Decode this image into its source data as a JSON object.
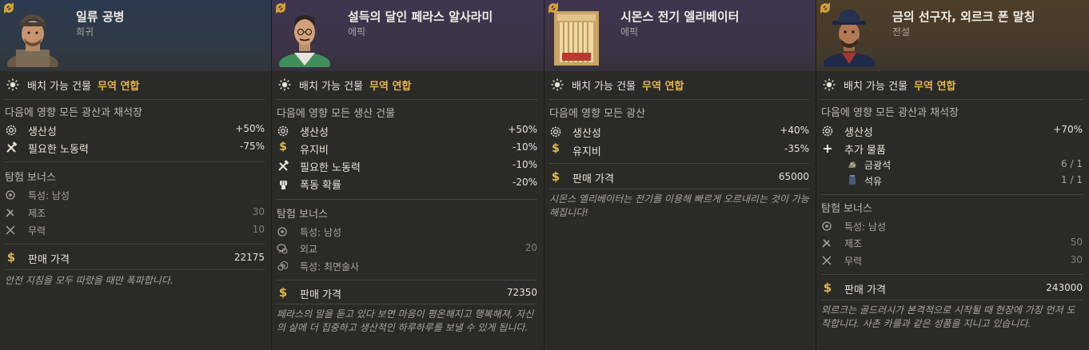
{
  "common": {
    "deploy_label": "배치 가능 건물",
    "deploy_value": "무역 연합",
    "explore_bonus": "탐험 보너스",
    "sell_price": "판매 가격"
  },
  "cards": [
    {
      "name": "일류 공병",
      "rarity": "희귀",
      "affects": "다음에 영향 모든 광산과 채석장",
      "stats": [
        {
          "icon": "gear-icon",
          "label": "생산성",
          "value": "+50%"
        },
        {
          "icon": "tools-icon",
          "label": "필요한 노동력",
          "value": "-75%"
        }
      ],
      "bonus": [
        {
          "icon": "trait-icon",
          "label": "특성:  남성",
          "value": ""
        },
        {
          "icon": "craft-icon",
          "label": "제조",
          "value": "30"
        },
        {
          "icon": "swords-icon",
          "label": "무력",
          "value": "10"
        }
      ],
      "price": "22175",
      "flavor": "안전 지침을 모두 따랐을 때만 폭파합니다."
    },
    {
      "name": "설득의 달인 페라스 알사라미",
      "rarity": "에픽",
      "affects": "다음에 영향 모든 생산 건물",
      "stats": [
        {
          "icon": "gear-icon",
          "label": "생산성",
          "value": "+50%"
        },
        {
          "icon": "dollar-icon",
          "label": "유지비",
          "value": "-10%"
        },
        {
          "icon": "tools-icon",
          "label": "필요한 노동력",
          "value": "-10%"
        },
        {
          "icon": "fist-icon",
          "label": "폭동 확률",
          "value": "-20%"
        }
      ],
      "bonus": [
        {
          "icon": "trait-icon",
          "label": "특성:  남성",
          "value": ""
        },
        {
          "icon": "diplomacy-icon",
          "label": "외교",
          "value": "20"
        },
        {
          "icon": "spiral-icon",
          "label": "특성:  최면술사",
          "value": ""
        }
      ],
      "price": "72350",
      "flavor": "페라스의 말을 듣고 있다 보면 마음이 평온해지고 행복해져, 자신의 삶에 더 집중하고 생산적인 하루하루를 보낼 수 있게 됩니다."
    },
    {
      "name": "시몬스 전기 엘리베이터",
      "rarity": "에픽",
      "affects": "다음에 영향 모든 광산",
      "stats": [
        {
          "icon": "gear-icon",
          "label": "생산성",
          "value": "+40%"
        },
        {
          "icon": "dollar-icon",
          "label": "유지비",
          "value": "-35%"
        }
      ],
      "price": "65000",
      "flavor": "시몬스 엘리베이터는 전기를 이용해 빠르게 오르내리는 것이 가능해집니다!"
    },
    {
      "name": "금의 선구자, 외르크 폰 말칭",
      "rarity": "전설",
      "affects": "다음에 영향 모든 광산과 채석장",
      "stats": [
        {
          "icon": "gear-icon",
          "label": "생산성",
          "value": "+70%"
        },
        {
          "icon": "plus-icon",
          "label": "추가 물품",
          "value": ""
        }
      ],
      "extra_items": [
        {
          "icon": "gold-ore-icon",
          "label": "금광석",
          "value": "6 / 1"
        },
        {
          "icon": "oil-icon",
          "label": "석유",
          "value": "1 / 1"
        }
      ],
      "bonus": [
        {
          "icon": "trait-icon",
          "label": "특성:  남성",
          "value": ""
        },
        {
          "icon": "craft-icon",
          "label": "제조",
          "value": "50"
        },
        {
          "icon": "swords-icon",
          "label": "무력",
          "value": "30"
        }
      ],
      "price": "243000",
      "flavor": "외르크는 골드러시가 본격적으로 시작될 때 현장에 가장 먼저 도착합니다. 사촌 카를과 같은 성품을 지니고 있습니다."
    }
  ]
}
